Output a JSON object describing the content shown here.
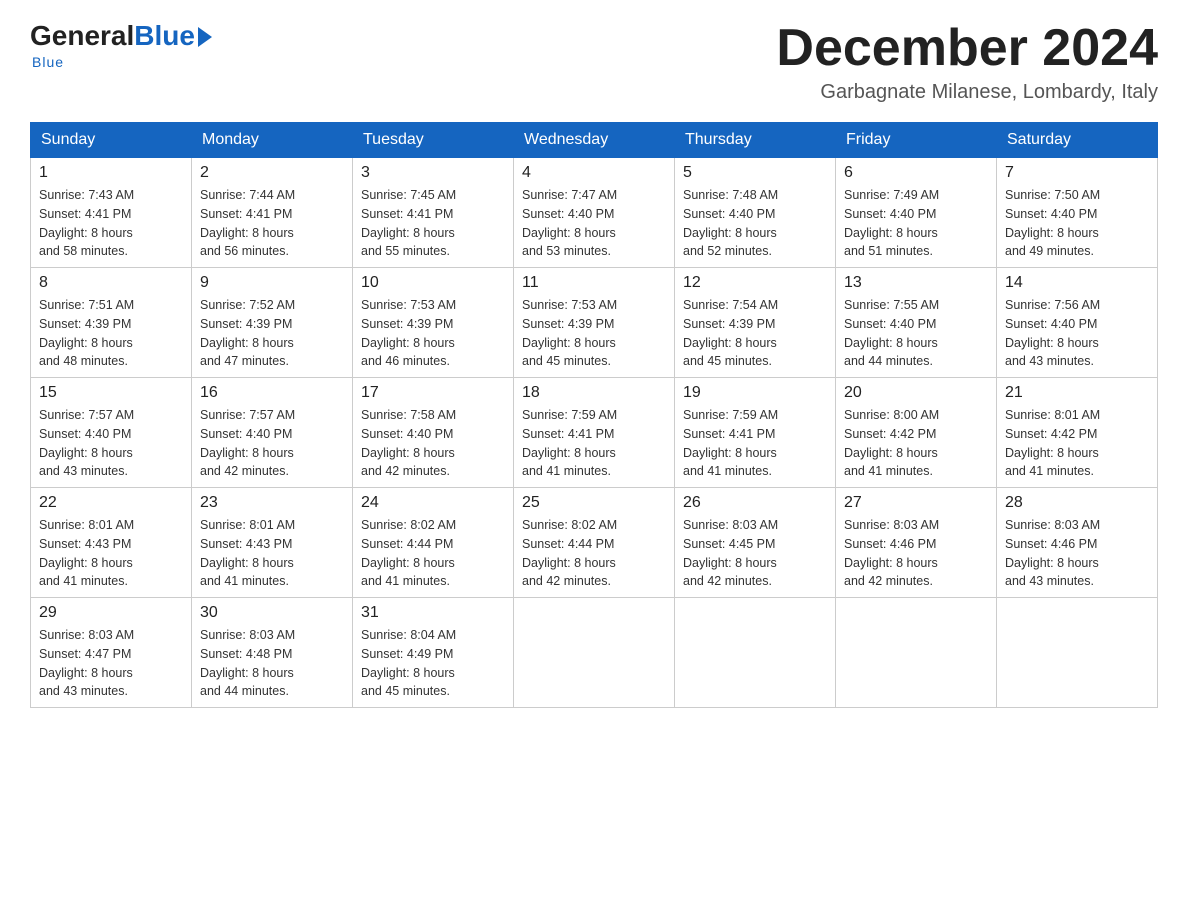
{
  "header": {
    "logo_general": "General",
    "logo_blue": "Blue",
    "logo_tagline": "Blue",
    "month_title": "December 2024",
    "location": "Garbagnate Milanese, Lombardy, Italy"
  },
  "weekdays": [
    "Sunday",
    "Monday",
    "Tuesday",
    "Wednesday",
    "Thursday",
    "Friday",
    "Saturday"
  ],
  "weeks": [
    [
      {
        "day": "1",
        "sunrise": "7:43 AM",
        "sunset": "4:41 PM",
        "daylight": "8 hours and 58 minutes."
      },
      {
        "day": "2",
        "sunrise": "7:44 AM",
        "sunset": "4:41 PM",
        "daylight": "8 hours and 56 minutes."
      },
      {
        "day": "3",
        "sunrise": "7:45 AM",
        "sunset": "4:41 PM",
        "daylight": "8 hours and 55 minutes."
      },
      {
        "day": "4",
        "sunrise": "7:47 AM",
        "sunset": "4:40 PM",
        "daylight": "8 hours and 53 minutes."
      },
      {
        "day": "5",
        "sunrise": "7:48 AM",
        "sunset": "4:40 PM",
        "daylight": "8 hours and 52 minutes."
      },
      {
        "day": "6",
        "sunrise": "7:49 AM",
        "sunset": "4:40 PM",
        "daylight": "8 hours and 51 minutes."
      },
      {
        "day": "7",
        "sunrise": "7:50 AM",
        "sunset": "4:40 PM",
        "daylight": "8 hours and 49 minutes."
      }
    ],
    [
      {
        "day": "8",
        "sunrise": "7:51 AM",
        "sunset": "4:39 PM",
        "daylight": "8 hours and 48 minutes."
      },
      {
        "day": "9",
        "sunrise": "7:52 AM",
        "sunset": "4:39 PM",
        "daylight": "8 hours and 47 minutes."
      },
      {
        "day": "10",
        "sunrise": "7:53 AM",
        "sunset": "4:39 PM",
        "daylight": "8 hours and 46 minutes."
      },
      {
        "day": "11",
        "sunrise": "7:53 AM",
        "sunset": "4:39 PM",
        "daylight": "8 hours and 45 minutes."
      },
      {
        "day": "12",
        "sunrise": "7:54 AM",
        "sunset": "4:39 PM",
        "daylight": "8 hours and 45 minutes."
      },
      {
        "day": "13",
        "sunrise": "7:55 AM",
        "sunset": "4:40 PM",
        "daylight": "8 hours and 44 minutes."
      },
      {
        "day": "14",
        "sunrise": "7:56 AM",
        "sunset": "4:40 PM",
        "daylight": "8 hours and 43 minutes."
      }
    ],
    [
      {
        "day": "15",
        "sunrise": "7:57 AM",
        "sunset": "4:40 PM",
        "daylight": "8 hours and 43 minutes."
      },
      {
        "day": "16",
        "sunrise": "7:57 AM",
        "sunset": "4:40 PM",
        "daylight": "8 hours and 42 minutes."
      },
      {
        "day": "17",
        "sunrise": "7:58 AM",
        "sunset": "4:40 PM",
        "daylight": "8 hours and 42 minutes."
      },
      {
        "day": "18",
        "sunrise": "7:59 AM",
        "sunset": "4:41 PM",
        "daylight": "8 hours and 41 minutes."
      },
      {
        "day": "19",
        "sunrise": "7:59 AM",
        "sunset": "4:41 PM",
        "daylight": "8 hours and 41 minutes."
      },
      {
        "day": "20",
        "sunrise": "8:00 AM",
        "sunset": "4:42 PM",
        "daylight": "8 hours and 41 minutes."
      },
      {
        "day": "21",
        "sunrise": "8:01 AM",
        "sunset": "4:42 PM",
        "daylight": "8 hours and 41 minutes."
      }
    ],
    [
      {
        "day": "22",
        "sunrise": "8:01 AM",
        "sunset": "4:43 PM",
        "daylight": "8 hours and 41 minutes."
      },
      {
        "day": "23",
        "sunrise": "8:01 AM",
        "sunset": "4:43 PM",
        "daylight": "8 hours and 41 minutes."
      },
      {
        "day": "24",
        "sunrise": "8:02 AM",
        "sunset": "4:44 PM",
        "daylight": "8 hours and 41 minutes."
      },
      {
        "day": "25",
        "sunrise": "8:02 AM",
        "sunset": "4:44 PM",
        "daylight": "8 hours and 42 minutes."
      },
      {
        "day": "26",
        "sunrise": "8:03 AM",
        "sunset": "4:45 PM",
        "daylight": "8 hours and 42 minutes."
      },
      {
        "day": "27",
        "sunrise": "8:03 AM",
        "sunset": "4:46 PM",
        "daylight": "8 hours and 42 minutes."
      },
      {
        "day": "28",
        "sunrise": "8:03 AM",
        "sunset": "4:46 PM",
        "daylight": "8 hours and 43 minutes."
      }
    ],
    [
      {
        "day": "29",
        "sunrise": "8:03 AM",
        "sunset": "4:47 PM",
        "daylight": "8 hours and 43 minutes."
      },
      {
        "day": "30",
        "sunrise": "8:03 AM",
        "sunset": "4:48 PM",
        "daylight": "8 hours and 44 minutes."
      },
      {
        "day": "31",
        "sunrise": "8:04 AM",
        "sunset": "4:49 PM",
        "daylight": "8 hours and 45 minutes."
      },
      null,
      null,
      null,
      null
    ]
  ],
  "labels": {
    "sunrise": "Sunrise:",
    "sunset": "Sunset:",
    "daylight": "Daylight:"
  }
}
